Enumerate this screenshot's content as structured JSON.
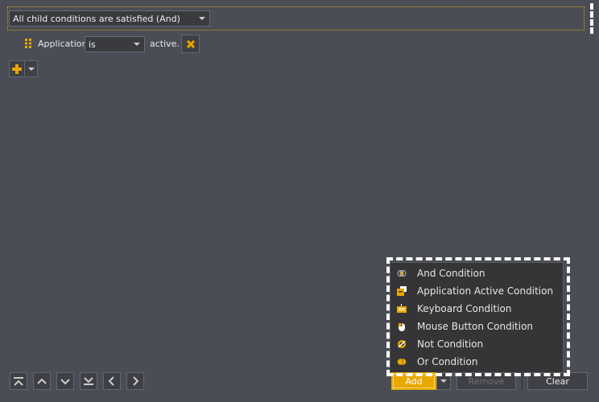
{
  "condition_group": {
    "mode_selected": "All child conditions are satisfied (And)"
  },
  "condition_row": {
    "subject": "Application",
    "operator": "is",
    "suffix": "active."
  },
  "add_menu": {
    "items": [
      {
        "label": "And Condition",
        "icon": "and-condition-icon"
      },
      {
        "label": "Application Active Condition",
        "icon": "application-window-icon"
      },
      {
        "label": "Keyboard Condition",
        "icon": "keyboard-icon"
      },
      {
        "label": "Mouse Button Condition",
        "icon": "mouse-icon"
      },
      {
        "label": "Not Condition",
        "icon": "not-condition-icon"
      },
      {
        "label": "Or Condition",
        "icon": "or-condition-icon"
      }
    ]
  },
  "buttons": {
    "add": "Add",
    "remove": "Remove",
    "clear": "Clear"
  },
  "colors": {
    "accent": "#e8a800",
    "background": "#4a4d55"
  }
}
